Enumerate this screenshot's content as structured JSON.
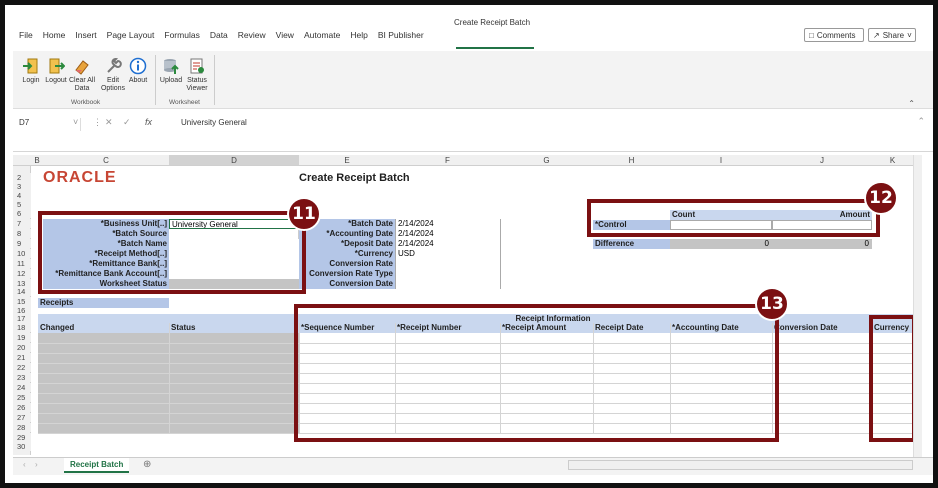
{
  "window": {
    "title": "Create Receipt Batch"
  },
  "menu": [
    "File",
    "Home",
    "Insert",
    "Page Layout",
    "Formulas",
    "Data",
    "Review",
    "View",
    "Automate",
    "Help",
    "BI Publisher"
  ],
  "top_buttons": {
    "comments": "Comments",
    "share": "Share"
  },
  "ribbon": {
    "buttons": [
      {
        "label": "Login",
        "icon": "login-icon"
      },
      {
        "label": "Logout",
        "icon": "logout-icon"
      },
      {
        "label": "Clear All Data",
        "icon": "eraser-icon"
      },
      {
        "label": "Edit Options",
        "icon": "wrench-icon"
      },
      {
        "label": "About",
        "icon": "info-icon"
      },
      {
        "label": "Upload",
        "icon": "upload-icon"
      },
      {
        "label": "Status Viewer",
        "icon": "status-viewer-icon"
      }
    ],
    "groups": [
      "Workbook",
      "Worksheet"
    ]
  },
  "formula_bar": {
    "name_box": "D7",
    "value": "University General"
  },
  "columns": [
    "B",
    "C",
    "D",
    "E",
    "F",
    "G",
    "H",
    "I",
    "J",
    "K"
  ],
  "rows": [
    "2",
    "3",
    "4",
    "5",
    "6",
    "7",
    "8",
    "9",
    "10",
    "11",
    "12",
    "13",
    "14",
    "15",
    "16",
    "17",
    "18",
    "19",
    "20",
    "21",
    "22",
    "23",
    "24",
    "25",
    "26",
    "27",
    "28",
    "29",
    "30"
  ],
  "logo": "ORACLE",
  "sheet_title": "Create Receipt Batch",
  "header_fields": {
    "business_unit_label": "*Business Unit[..]",
    "business_unit_value": "University General",
    "batch_source_label": "*Batch Source",
    "batch_name_label": "*Batch Name",
    "receipt_method_label": "*Receipt Method[..]",
    "remittance_bank_label": "*Remittance Bank[..]",
    "remittance_account_label": "*Remittance Bank Account[..]",
    "worksheet_status_label": "Worksheet Status"
  },
  "date_fields": {
    "batch_date_label": "*Batch Date",
    "batch_date_value": "2/14/2024",
    "accounting_date_label": "*Accounting Date",
    "accounting_date_value": "2/14/2024",
    "deposit_date_label": "*Deposit Date",
    "deposit_date_value": "2/14/2024",
    "currency_label": "*Currency",
    "currency_value": "USD",
    "conversion_rate_label": "Conversion Rate",
    "conversion_rate_type_label": "Conversion Rate Type",
    "conversion_date_label": "Conversion Date"
  },
  "control": {
    "count_header": "Count",
    "amount_header": "Amount",
    "control_label": "*Control",
    "difference_label": "Difference",
    "difference_count": "0",
    "difference_amount": "0"
  },
  "receipts": {
    "section_label": "Receipts",
    "group_header": "Receipt Information",
    "columns": [
      "Changed",
      "Status",
      "*Sequence Number",
      "*Receipt Number",
      "*Receipt Amount",
      "Receipt Date",
      "*Accounting Date",
      "Conversion Date",
      "Currency"
    ]
  },
  "badges": [
    "11",
    "12",
    "13"
  ],
  "sheet_tab": "Receipt Batch",
  "colors": {
    "accent": "#217346",
    "callout": "#7b1012",
    "label_blue": "#b4c6e7"
  }
}
